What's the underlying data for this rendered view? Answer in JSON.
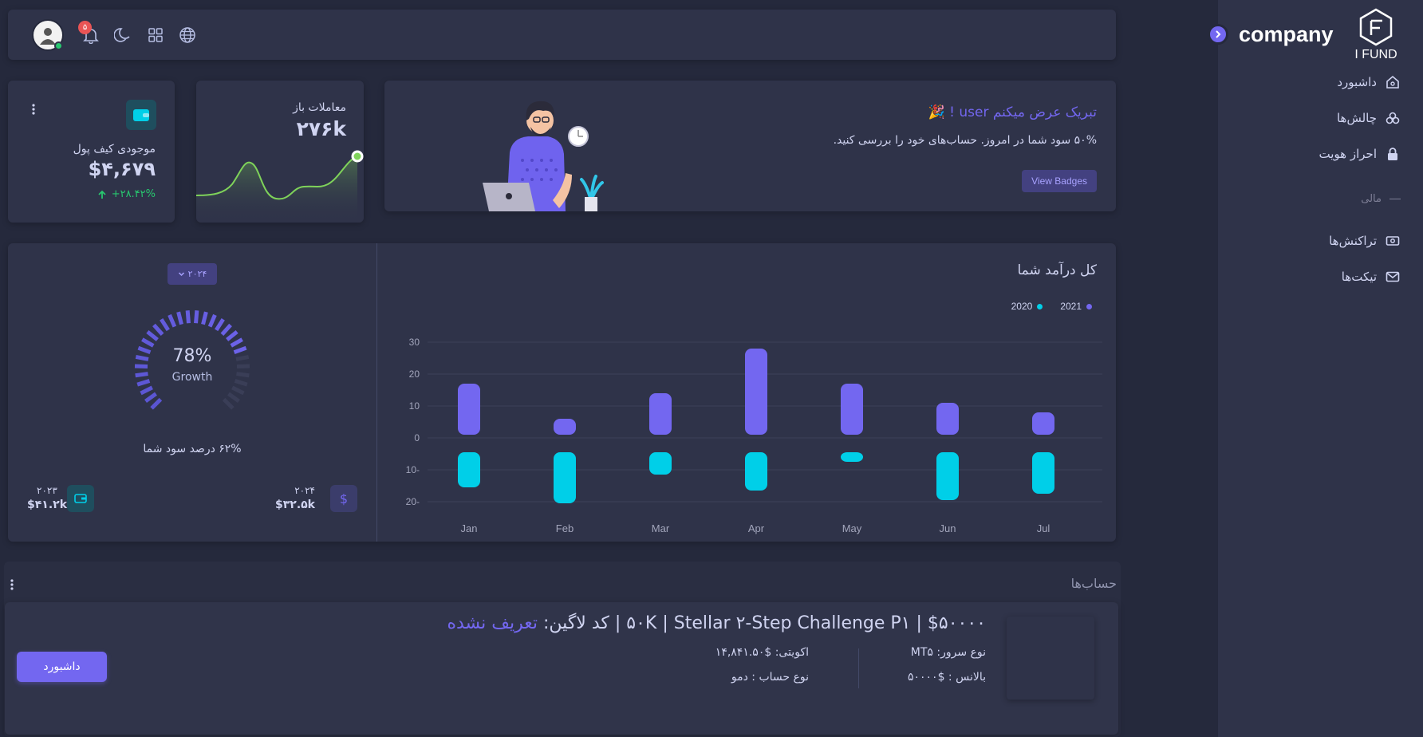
{
  "brand": {
    "name": "company",
    "logo_text": "I FUND"
  },
  "sidebar": {
    "items": [
      {
        "label": "داشبورد",
        "icon": "home-icon"
      },
      {
        "label": "چالش‌ها",
        "icon": "challenge-icon"
      },
      {
        "label": "احراز هویت",
        "icon": "lock-icon"
      }
    ],
    "section_label": "مالی",
    "finance_items": [
      {
        "label": "تراکنش‌ها",
        "icon": "cash-icon"
      },
      {
        "label": "تیکت‌ها",
        "icon": "mail-icon"
      }
    ]
  },
  "topbar": {
    "notification_count": "۵"
  },
  "welcome": {
    "title": "تبریک عرض میکنم user ! 🎉",
    "subtitle": "۵۰% سود شما در امروز. حساب‌های خود را بررسی کنید.",
    "button": "View Badges"
  },
  "trades": {
    "label": "معاملات باز",
    "value": "۲۷۶k"
  },
  "wallet": {
    "label": "موجودی کیف پول",
    "value": "$۴,۶۷۹",
    "change": "+۲۸.۴۲%"
  },
  "revenue": {
    "title": "کل درآمد شما",
    "year_button": "۲۰۲۴",
    "growth_value": "78%",
    "growth_label": "Growth",
    "growth_percent": 78,
    "profit_text": "۶۲% درصد سود شما",
    "stat_2024": {
      "year": "۲۰۲۴",
      "value": "$۳۲.۵k"
    },
    "stat_2023": {
      "year": "۲۰۲۳",
      "value": "$۴۱.۲k"
    }
  },
  "chart_data": {
    "type": "bar",
    "categories": [
      "Jan",
      "Feb",
      "Mar",
      "Apr",
      "May",
      "Jun",
      "Jul"
    ],
    "series": [
      {
        "name": "2021",
        "values": [
          17,
          6,
          14,
          28,
          17,
          11,
          8
        ],
        "color": "#7367f0"
      },
      {
        "name": "2020",
        "values": [
          -12,
          -17,
          -8,
          -13,
          -4,
          -16,
          -14
        ],
        "color": "#00cfe8"
      }
    ],
    "y_ticks": [
      "30",
      "20",
      "10",
      "0",
      "10-",
      "20-"
    ],
    "ylim": [
      -20,
      30
    ]
  },
  "accounts": {
    "title": "حساب‌ها",
    "account_title": "$۵۰۰۰۰ | ۵۰K | Stellar ۲-Step Challenge P۱ | کد لاگین: ",
    "login_code": "تعریف نشده",
    "server_type": "نوع سرور: MT۵",
    "balance": "بالانس : $۵۰۰۰۰",
    "equity": "اکویتی: $۱۴,۸۴۱.۵۰",
    "account_type": "نوع حساب : دمو",
    "dashboard_button": "داشبورد"
  }
}
